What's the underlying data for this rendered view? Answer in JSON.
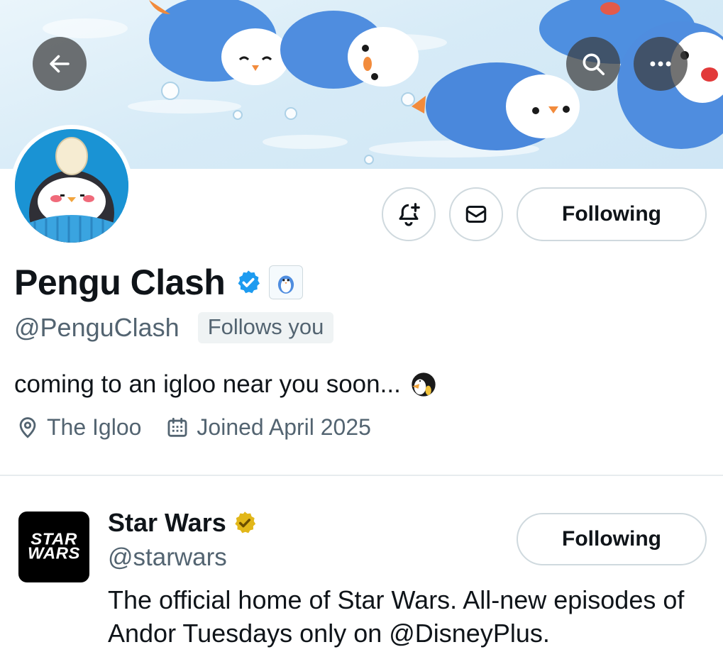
{
  "header": {
    "back_icon": "arrow-left-icon",
    "search_icon": "search-icon",
    "more_icon": "more-horizontal-icon"
  },
  "profile": {
    "display_name": "Pengu Clash",
    "verified_badge_icon": "verified-blue-icon",
    "affiliate_badge_icon": "penguin-affiliate-icon",
    "handle": "@PenguClash",
    "follows_you_label": "Follows you",
    "bio": "coming to an igloo near you soon...",
    "bio_emoji_icon": "penguin-emoji-icon",
    "location": "The Igloo",
    "location_icon": "location-pin-icon",
    "joined": "Joined April 2025",
    "joined_icon": "calendar-icon"
  },
  "actions": {
    "notify_icon": "bell-plus-icon",
    "message_icon": "mail-icon",
    "follow_label": "Following"
  },
  "suggested_account": {
    "name": "Star Wars",
    "avatar_text_line1": "STAR",
    "avatar_text_line2": "WARS",
    "verified_badge_icon": "verified-gold-icon",
    "handle": "@starwars",
    "bio": "The official home of Star Wars. All-new episodes of Andor Tuesdays only on @DisneyPlus.",
    "follow_label": "Following"
  },
  "colors": {
    "verified_blue": "#1d9bf0",
    "verified_gold": "#e2b719",
    "secondary_text": "#536471",
    "border": "#cfd9de"
  }
}
